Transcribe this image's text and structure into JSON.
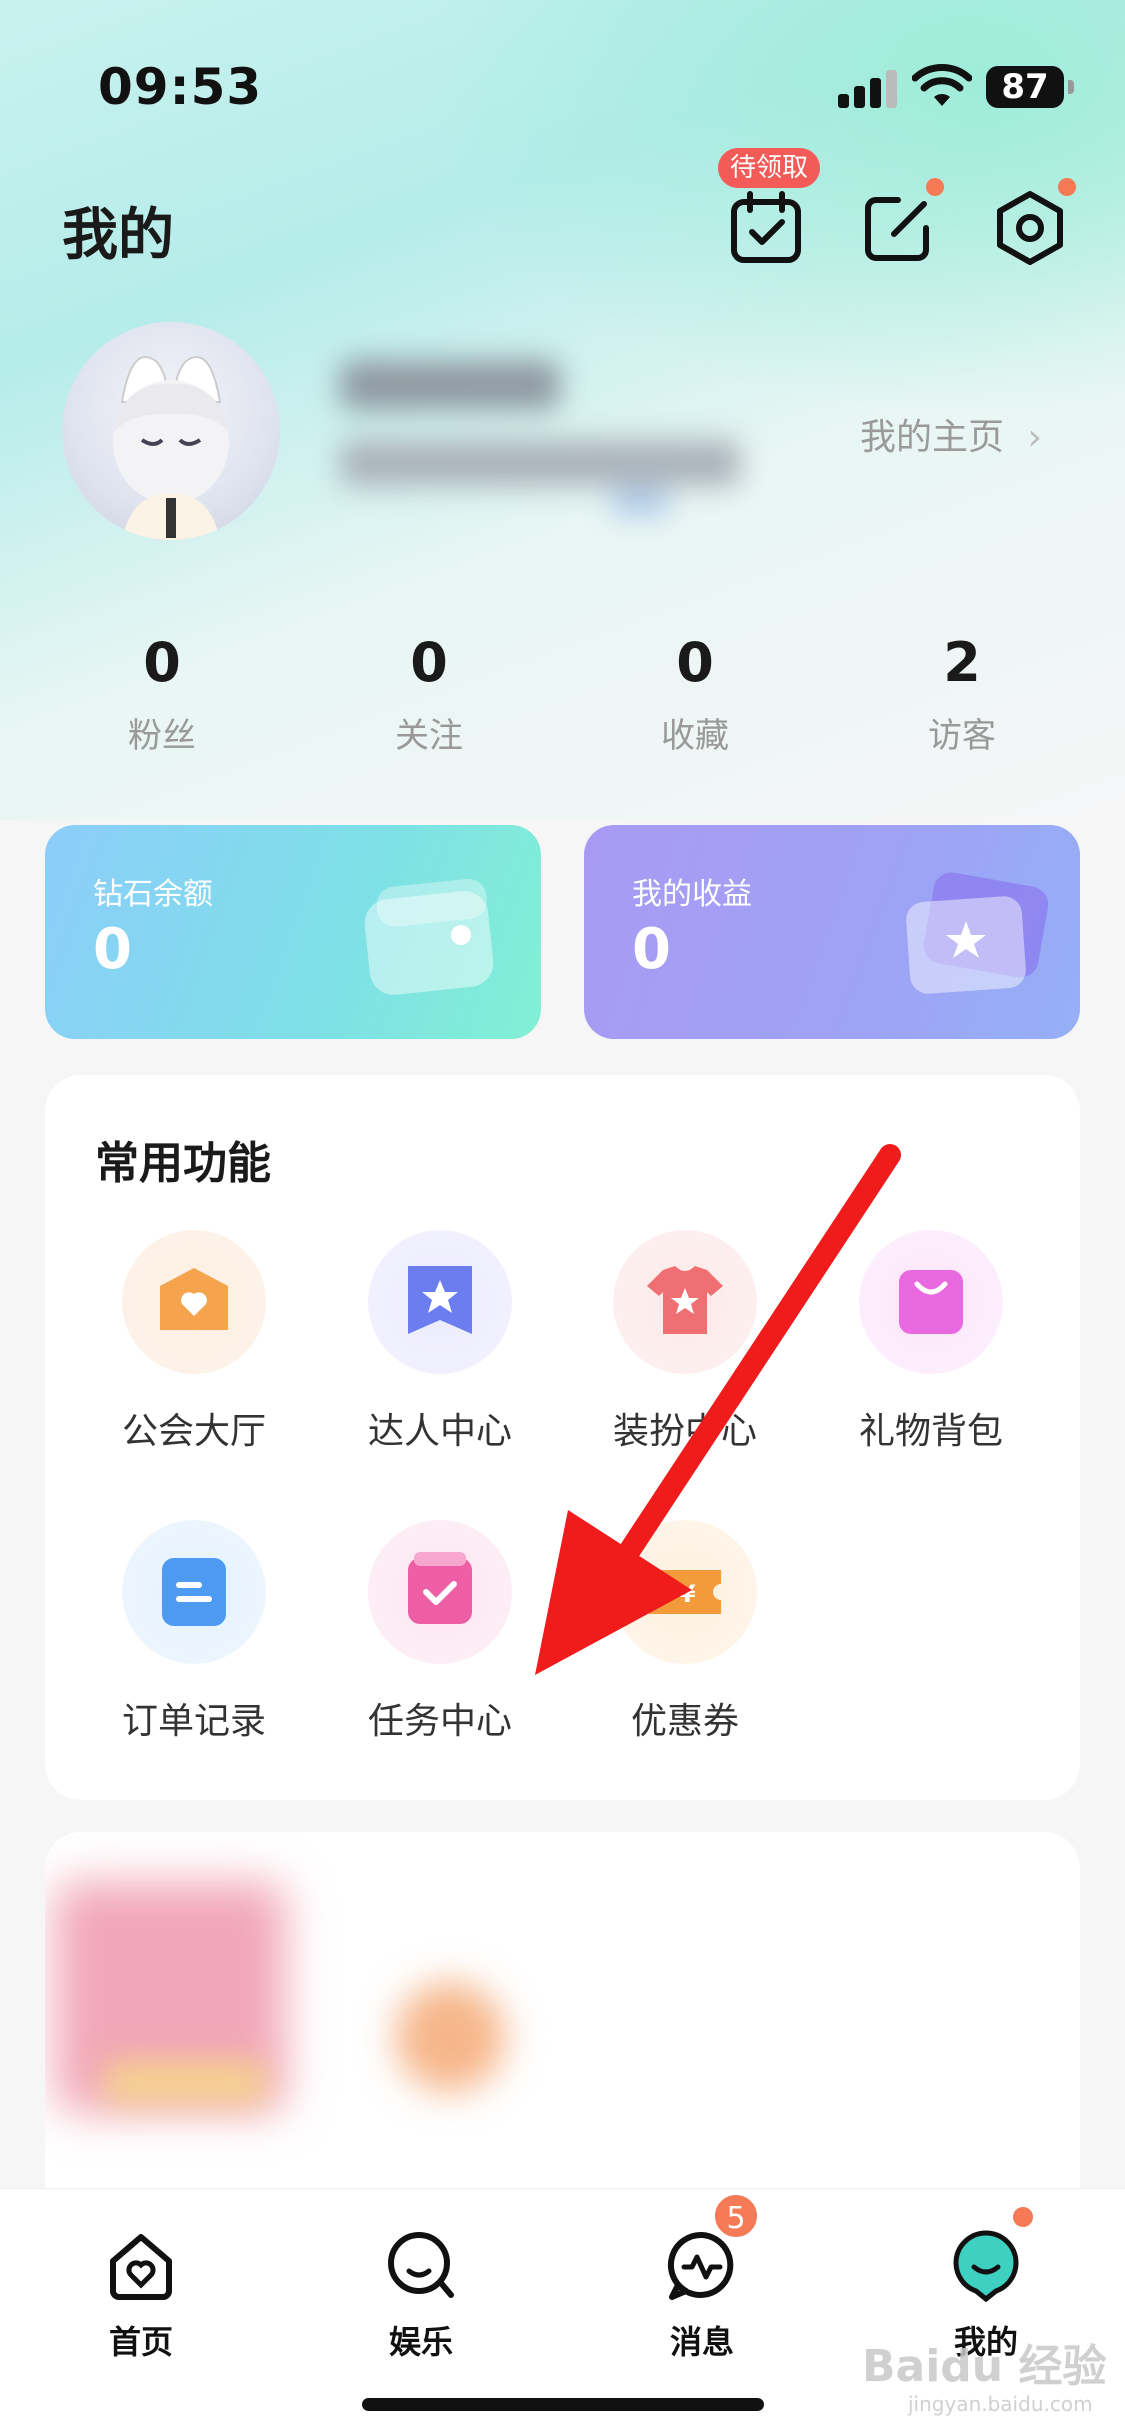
{
  "status": {
    "time": "09:53",
    "battery": "87"
  },
  "header": {
    "title": "我的",
    "checkin_badge": "待领取"
  },
  "profile": {
    "home_link": "我的主页"
  },
  "stats": [
    {
      "value": "0",
      "label": "粉丝"
    },
    {
      "value": "0",
      "label": "关注"
    },
    {
      "value": "0",
      "label": "收藏"
    },
    {
      "value": "2",
      "label": "访客"
    }
  ],
  "wallet": {
    "diamond": {
      "title": "钻石余额",
      "value": "0"
    },
    "income": {
      "title": "我的收益",
      "value": "0"
    }
  },
  "features": {
    "title": "常用功能",
    "items": [
      {
        "label": "公会大厅",
        "icon": "heart-house-icon"
      },
      {
        "label": "达人中心",
        "icon": "star-ribbon-icon"
      },
      {
        "label": "装扮中心",
        "icon": "tshirt-icon"
      },
      {
        "label": "礼物背包",
        "icon": "gift-bag-icon"
      },
      {
        "label": "订单记录",
        "icon": "order-list-icon"
      },
      {
        "label": "任务中心",
        "icon": "task-check-icon"
      },
      {
        "label": "优惠券",
        "icon": "coupon-icon"
      }
    ]
  },
  "tabbar": {
    "items": [
      {
        "label": "首页",
        "icon": "home-icon"
      },
      {
        "label": "娱乐",
        "icon": "entertainment-icon"
      },
      {
        "label": "消息",
        "icon": "message-icon",
        "badge": "5"
      },
      {
        "label": "我的",
        "icon": "profile-icon"
      }
    ]
  },
  "watermark": {
    "brand": "Baidu 经验",
    "url": "jingyan.baidu.com"
  },
  "colors": {
    "accent_red": "#f25b58",
    "badge_orange": "#f57a55",
    "active_tab": "#3ed0c0"
  }
}
